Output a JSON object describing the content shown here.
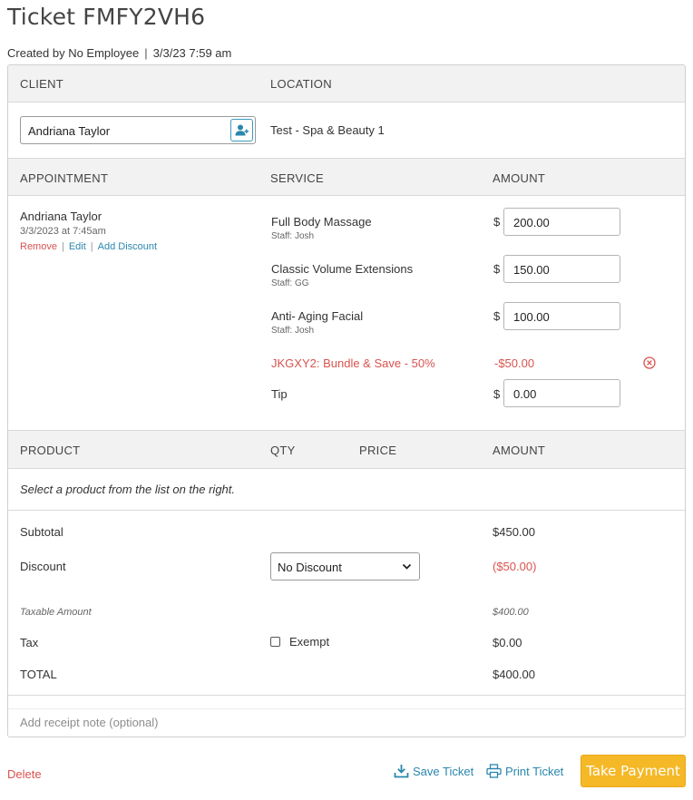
{
  "ticket": {
    "title": "Ticket FMFY2VH6",
    "created_by": "Created by No Employee",
    "created_at": "3/3/23 7:59 am"
  },
  "client_section": {
    "client_header": "CLIENT",
    "location_header": "LOCATION",
    "client_value": "Andriana Taylor",
    "location_value": "Test - Spa & Beauty 1"
  },
  "appointment_section": {
    "appointment_header": "APPOINTMENT",
    "service_header": "SERVICE",
    "amount_header": "AMOUNT",
    "client_name": "Andriana Taylor",
    "date": "3/3/2023 at 7:45am",
    "remove_label": "Remove",
    "edit_label": "Edit",
    "add_discount_label": "Add Discount",
    "currency_symbol": "$",
    "services": [
      {
        "name": "Full Body Massage",
        "staff": "Staff: Josh",
        "amount": "200.00"
      },
      {
        "name": "Classic Volume Extensions",
        "staff": "Staff: GG",
        "amount": "150.00"
      },
      {
        "name": "Anti- Aging Facial",
        "staff": "Staff: Josh",
        "amount": "100.00"
      }
    ],
    "bundle_discount": {
      "label": "JKGXY2: Bundle & Save - 50%",
      "amount": "-$50.00"
    },
    "tip": {
      "label": "Tip",
      "amount": "0.00"
    }
  },
  "product_section": {
    "product_header": "PRODUCT",
    "qty_header": "QTY",
    "price_header": "PRICE",
    "amount_header": "AMOUNT",
    "empty_text": "Select a product from the list on the right."
  },
  "totals": {
    "subtotal_label": "Subtotal",
    "subtotal_value": "$450.00",
    "discount_label": "Discount",
    "discount_select": "No Discount",
    "discount_value": "($50.00)",
    "taxable_label": "Taxable Amount",
    "taxable_value": "$400.00",
    "tax_label": "Tax",
    "exempt_label": "Exempt",
    "tax_value": "$0.00",
    "total_label": "TOTAL",
    "total_value": "$400.00"
  },
  "receipt_note": {
    "placeholder": "Add receipt note (optional)"
  },
  "actions": {
    "delete_label": "Delete",
    "save_label": "Save Ticket",
    "print_label": "Print Ticket",
    "take_payment_label": "Take Payment"
  },
  "colors": {
    "accent_blue": "#2a87ad",
    "danger_red": "#d9534f",
    "payment_yellow": "#f5b826"
  },
  "icons": {
    "client_button": "add-user-icon",
    "remove_discount": "circle-x-icon",
    "save": "download-icon",
    "print": "printer-icon",
    "select": "chevron-down-icon"
  }
}
